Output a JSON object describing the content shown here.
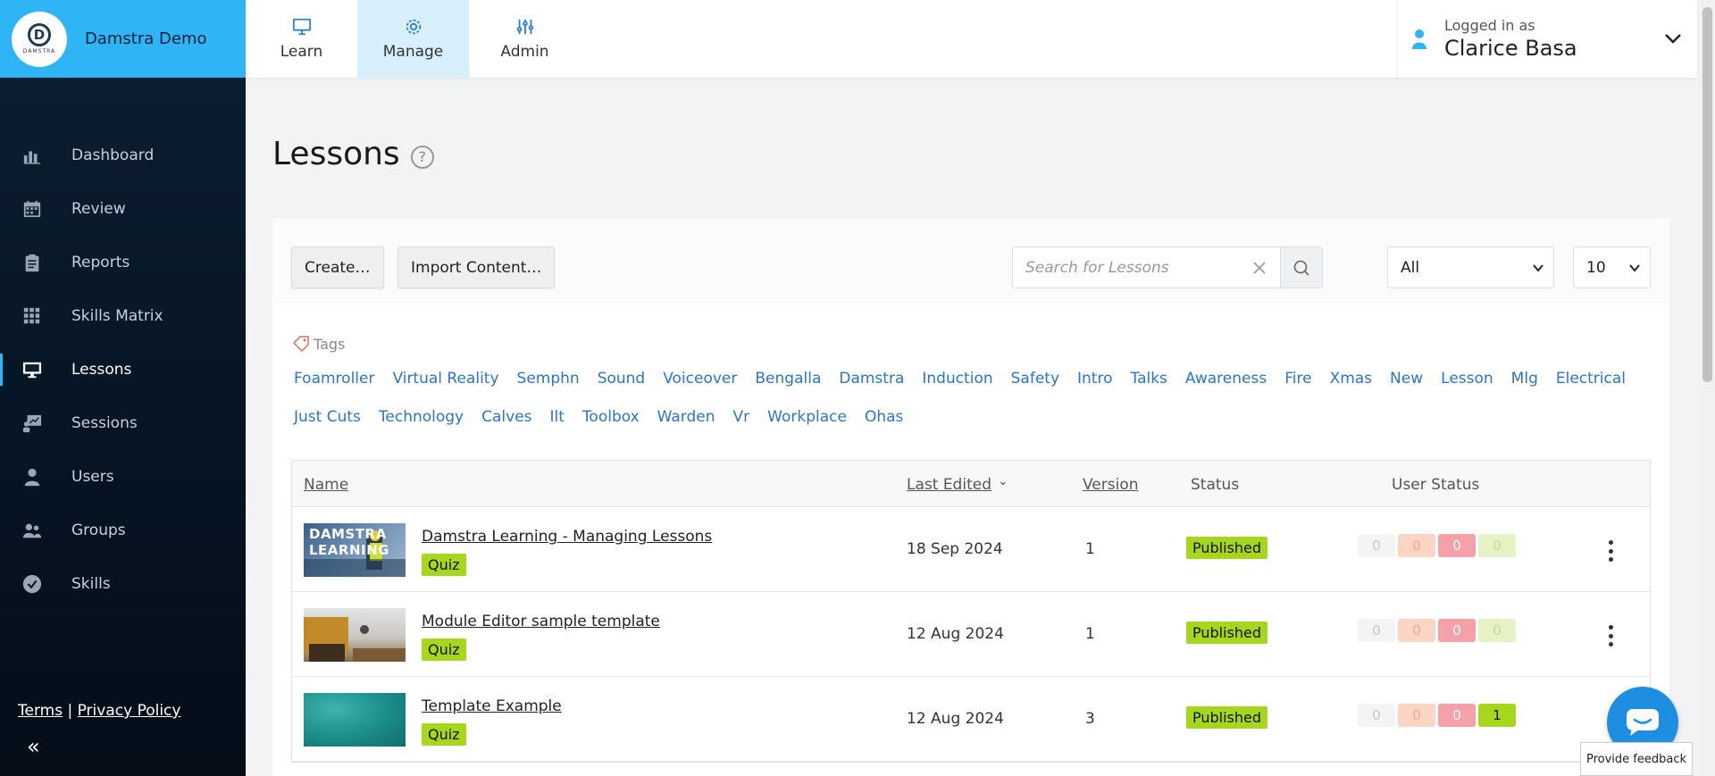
{
  "brand": {
    "name": "Damstra Demo",
    "logo_text": "DAMSTRA",
    "logo_letter": "D"
  },
  "top_tabs": [
    {
      "label": "Learn",
      "icon": "monitor-icon"
    },
    {
      "label": "Manage",
      "icon": "gear-icon",
      "active": true
    },
    {
      "label": "Admin",
      "icon": "sliders-icon"
    }
  ],
  "user": {
    "label": "Logged in as",
    "name": "Clarice Basa"
  },
  "sidebar": {
    "items": [
      {
        "label": "Dashboard",
        "icon": "bar-chart-icon"
      },
      {
        "label": "Review",
        "icon": "calendar-icon"
      },
      {
        "label": "Reports",
        "icon": "clipboard-icon"
      },
      {
        "label": "Skills Matrix",
        "icon": "grid-icon"
      },
      {
        "label": "Lessons",
        "icon": "monitor-icon",
        "active": true
      },
      {
        "label": "Sessions",
        "icon": "presentation-icon"
      },
      {
        "label": "Users",
        "icon": "user-icon"
      },
      {
        "label": "Groups",
        "icon": "group-icon"
      },
      {
        "label": "Skills",
        "icon": "check-circle-icon"
      }
    ],
    "terms": "Terms",
    "separator": "|",
    "privacy": "Privacy Policy",
    "collapse": "«"
  },
  "page": {
    "title": "Lessons",
    "help": "?"
  },
  "toolbar": {
    "create": "Create…",
    "import": "Import Content…",
    "search_placeholder": "Search for Lessons",
    "filter_value": "All",
    "page_size": "10"
  },
  "tags": {
    "heading": "Tags",
    "items": [
      "Foamroller",
      "Virtual Reality",
      "Semphn",
      "Sound",
      "Voiceover",
      "Bengalla",
      "Damstra",
      "Induction",
      "Safety",
      "Intro",
      "Talks",
      "Awareness",
      "Fire",
      "Xmas",
      "New",
      "Lesson",
      "Mlg",
      "Electrical",
      "Just Cuts",
      "Technology",
      "Calves",
      "Ilt",
      "Toolbox",
      "Warden",
      "Vr",
      "Workplace",
      "Ohas"
    ]
  },
  "table": {
    "headers": {
      "name": "Name",
      "last_edited": "Last Edited",
      "sort_indicator": "⌄",
      "version": "Version",
      "status": "Status",
      "user_status": "User Status"
    },
    "rows": [
      {
        "name": "Damstra Learning - Managing Lessons",
        "type": "Quiz",
        "last_edited": "18 Sep 2024",
        "version": "1",
        "status": "Published",
        "user_status": [
          "0",
          "0",
          "0",
          "0"
        ],
        "thumb_text": "DAMSTRA LEARNING"
      },
      {
        "name": "Module Editor sample template",
        "type": "Quiz",
        "last_edited": "12 Aug 2024",
        "version": "1",
        "status": "Published",
        "user_status": [
          "0",
          "0",
          "0",
          "0"
        ]
      },
      {
        "name": "Template Example",
        "type": "Quiz",
        "last_edited": "12 Aug 2024",
        "version": "3",
        "status": "Published",
        "user_status": [
          "0",
          "0",
          "0",
          "1"
        ]
      }
    ]
  },
  "feedback": "Provide feedback",
  "colors": {
    "brand": "#2fb5f5",
    "sidebar": "#0c1f33",
    "accent": "#2b7fd6",
    "published": "#a6d71e",
    "active_tab": "#d8effd"
  }
}
